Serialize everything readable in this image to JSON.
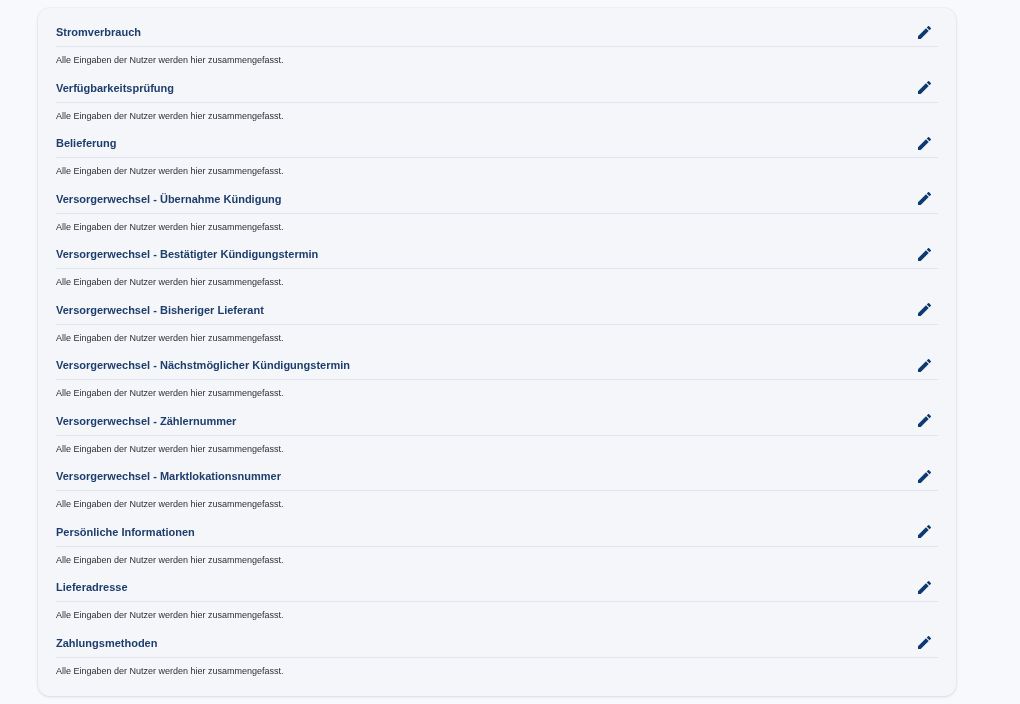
{
  "sections": [
    {
      "title": "Stromverbrauch",
      "description": "Alle Eingaben der Nutzer werden hier zusammengefasst."
    },
    {
      "title": "Verfügbarkeitsprüfung",
      "description": "Alle Eingaben der Nutzer werden hier zusammengefasst."
    },
    {
      "title": "Belieferung",
      "description": "Alle Eingaben der Nutzer werden hier zusammengefasst."
    },
    {
      "title": "Versorgerwechsel - Übernahme Kündigung",
      "description": "Alle Eingaben der Nutzer werden hier zusammengefasst."
    },
    {
      "title": "Versorgerwechsel - Bestätigter Kündigungstermin",
      "description": "Alle Eingaben der Nutzer werden hier zusammengefasst."
    },
    {
      "title": "Versorgerwechsel - Bisheriger Lieferant",
      "description": "Alle Eingaben der Nutzer werden hier zusammengefasst."
    },
    {
      "title": "Versorgerwechsel - Nächstmöglicher Kündigungstermin",
      "description": "Alle Eingaben der Nutzer werden hier zusammengefasst."
    },
    {
      "title": "Versorgerwechsel - Zählernummer",
      "description": "Alle Eingaben der Nutzer werden hier zusammengefasst."
    },
    {
      "title": "Versorgerwechsel - Marktlokationsnummer",
      "description": "Alle Eingaben der Nutzer werden hier zusammengefasst."
    },
    {
      "title": "Persönliche Informationen",
      "description": "Alle Eingaben der Nutzer werden hier zusammengefasst."
    },
    {
      "title": "Lieferadresse",
      "description": "Alle Eingaben der Nutzer werden hier zusammengefasst."
    },
    {
      "title": "Zahlungsmethoden",
      "description": "Alle Eingaben der Nutzer werden hier zusammengefasst."
    }
  ]
}
